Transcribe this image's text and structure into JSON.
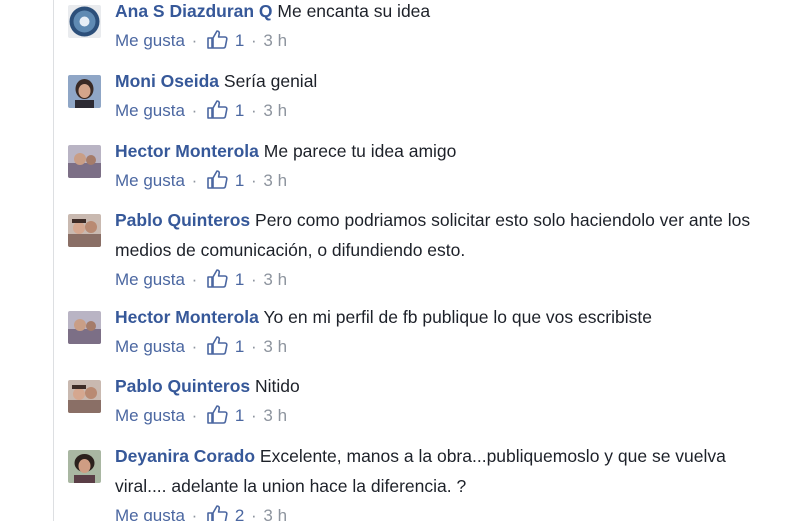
{
  "comments": [
    {
      "author": "Ana S Diazduran Q",
      "text": "Me encanta su idea",
      "like_label": "Me gusta",
      "like_count": "1",
      "time": "3 h"
    },
    {
      "author": "Moni Oseida",
      "text": "Sería genial",
      "like_label": "Me gusta",
      "like_count": "1",
      "time": "3 h"
    },
    {
      "author": "Hector Monterola",
      "text": "Me parece tu idea amigo",
      "like_label": "Me gusta",
      "like_count": "1",
      "time": "3 h"
    },
    {
      "author": "Pablo Quinteros",
      "text": "Pero como podriamos solicitar esto solo haciendolo ver ante los medios de comunicación, o difundiendo esto.",
      "like_label": "Me gusta",
      "like_count": "1",
      "time": "3 h"
    },
    {
      "author": "Hector Monterola",
      "text": "Yo en mi perfil de fb publique lo que vos escribiste",
      "like_label": "Me gusta",
      "like_count": "1",
      "time": "3 h"
    },
    {
      "author": "Pablo Quinteros",
      "text": "Nitido",
      "like_label": "Me gusta",
      "like_count": "1",
      "time": "3 h"
    },
    {
      "author": "Deyanira Corado",
      "text": "Excelente, manos a la obra...publiquemoslo y que se vuelva viral.... adelante la union hace la diferencia. ?",
      "like_label": "Me gusta",
      "like_count": "2",
      "time": "3 h"
    }
  ],
  "separator": "·",
  "colors": {
    "author": "#365899",
    "link": "#4b67a1",
    "meta": "#8d949e",
    "text": "#1d2129"
  },
  "icons": {
    "like": "thumbs-up-icon"
  }
}
